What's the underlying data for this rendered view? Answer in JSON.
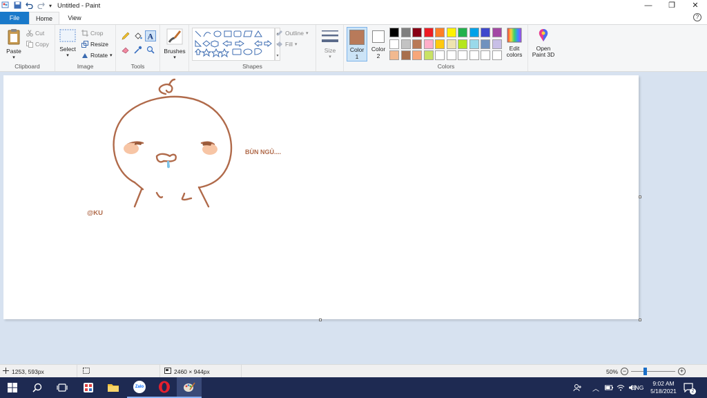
{
  "window": {
    "title": "Untitled - Paint",
    "controls": {
      "minimize": "—",
      "maximize": "❐",
      "close": "✕"
    }
  },
  "quick_access": {
    "save_icon": "floppy-icon",
    "undo_icon": "undo-icon",
    "redo_icon": "redo-icon"
  },
  "tabs": {
    "file": "File",
    "home": "Home",
    "view": "View",
    "help": "?"
  },
  "ribbon": {
    "clipboard": {
      "label": "Clipboard",
      "paste": "Paste",
      "cut": "Cut",
      "copy": "Copy"
    },
    "image": {
      "label": "Image",
      "select": "Select",
      "crop": "Crop",
      "resize": "Resize",
      "rotate": "Rotate"
    },
    "tools": {
      "label": "Tools"
    },
    "brushes": {
      "label": "Brushes"
    },
    "shapes": {
      "label": "Shapes",
      "outline": "Outline",
      "fill": "Fill"
    },
    "size": {
      "label": "Size"
    },
    "color1": {
      "label": "Color",
      "num": "1",
      "value": "#b87a5a"
    },
    "color2": {
      "label": "Color",
      "num": "2",
      "value": "#ffffff"
    },
    "colors": {
      "label": "Colors",
      "row1": [
        "#000000",
        "#7f7f7f",
        "#880015",
        "#ed1c24",
        "#ff7f27",
        "#fff200",
        "#22b14c",
        "#00a2e8",
        "#3f48cc",
        "#a349a4"
      ],
      "row2": [
        "#ffffff",
        "#c3c3c3",
        "#b97a57",
        "#ffaec9",
        "#ffc90e",
        "#efe4b0",
        "#b5e61d",
        "#99d9ea",
        "#7092be",
        "#c8bfe7"
      ],
      "row3": [
        "#f2b98f",
        "#a86f4c",
        "#f7a77a",
        "#c9e265",
        "#ffffff",
        "#ffffff",
        "#ffffff",
        "#ffffff",
        "#ffffff",
        "#ffffff"
      ],
      "edit_colors": "Edit colors"
    },
    "paint3d": {
      "label": "Open Paint 3D"
    }
  },
  "canvas": {
    "drawing_text": "BÙN NGỦ....",
    "signature": "@KU",
    "stroke_color": "#b06a4a",
    "blush_color": "#f7c5a5",
    "drool_color": "#7cc3e8"
  },
  "status": {
    "cursor_pos": "1253, 593px",
    "image_size": "2460 × 944px",
    "zoom": "50%",
    "zoom_fraction": 0.5
  },
  "taskbar": {
    "lang": "ENG",
    "time": "9:02 AM",
    "date": "5/18/2021",
    "notifications": "2",
    "zalo_label": "Zalo"
  }
}
